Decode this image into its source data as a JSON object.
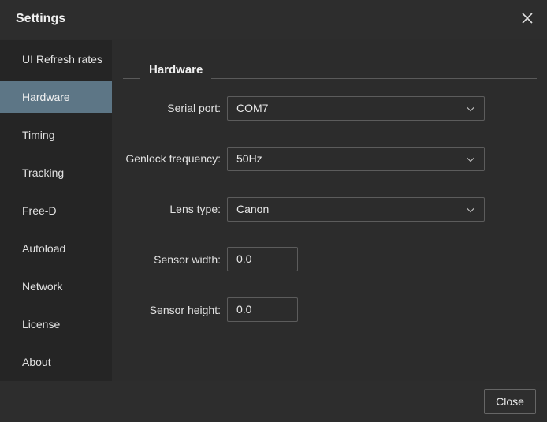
{
  "window": {
    "title": "Settings"
  },
  "sidebar": {
    "items": [
      {
        "label": "UI Refresh rates",
        "active": false
      },
      {
        "label": "Hardware",
        "active": true
      },
      {
        "label": "Timing",
        "active": false
      },
      {
        "label": "Tracking",
        "active": false
      },
      {
        "label": "Free-D",
        "active": false
      },
      {
        "label": "Autoload",
        "active": false
      },
      {
        "label": "Network",
        "active": false
      },
      {
        "label": "License",
        "active": false
      },
      {
        "label": "About",
        "active": false
      }
    ]
  },
  "hardware": {
    "group_title": "Hardware",
    "serial_port": {
      "label": "Serial port:",
      "value": "COM7"
    },
    "genlock_frequency": {
      "label": "Genlock frequency:",
      "value": "50Hz"
    },
    "lens_type": {
      "label": "Lens type:",
      "value": "Canon"
    },
    "sensor_width": {
      "label": "Sensor width:",
      "value": "0.0"
    },
    "sensor_height": {
      "label": "Sensor height:",
      "value": "0.0"
    }
  },
  "footer": {
    "close_label": "Close"
  },
  "icons": {
    "close": "close-icon",
    "dropdown": "chevron-down-icon"
  },
  "colors": {
    "active_nav": "#5d7686",
    "background": "#2c2c2c",
    "sidebar": "#252525"
  }
}
